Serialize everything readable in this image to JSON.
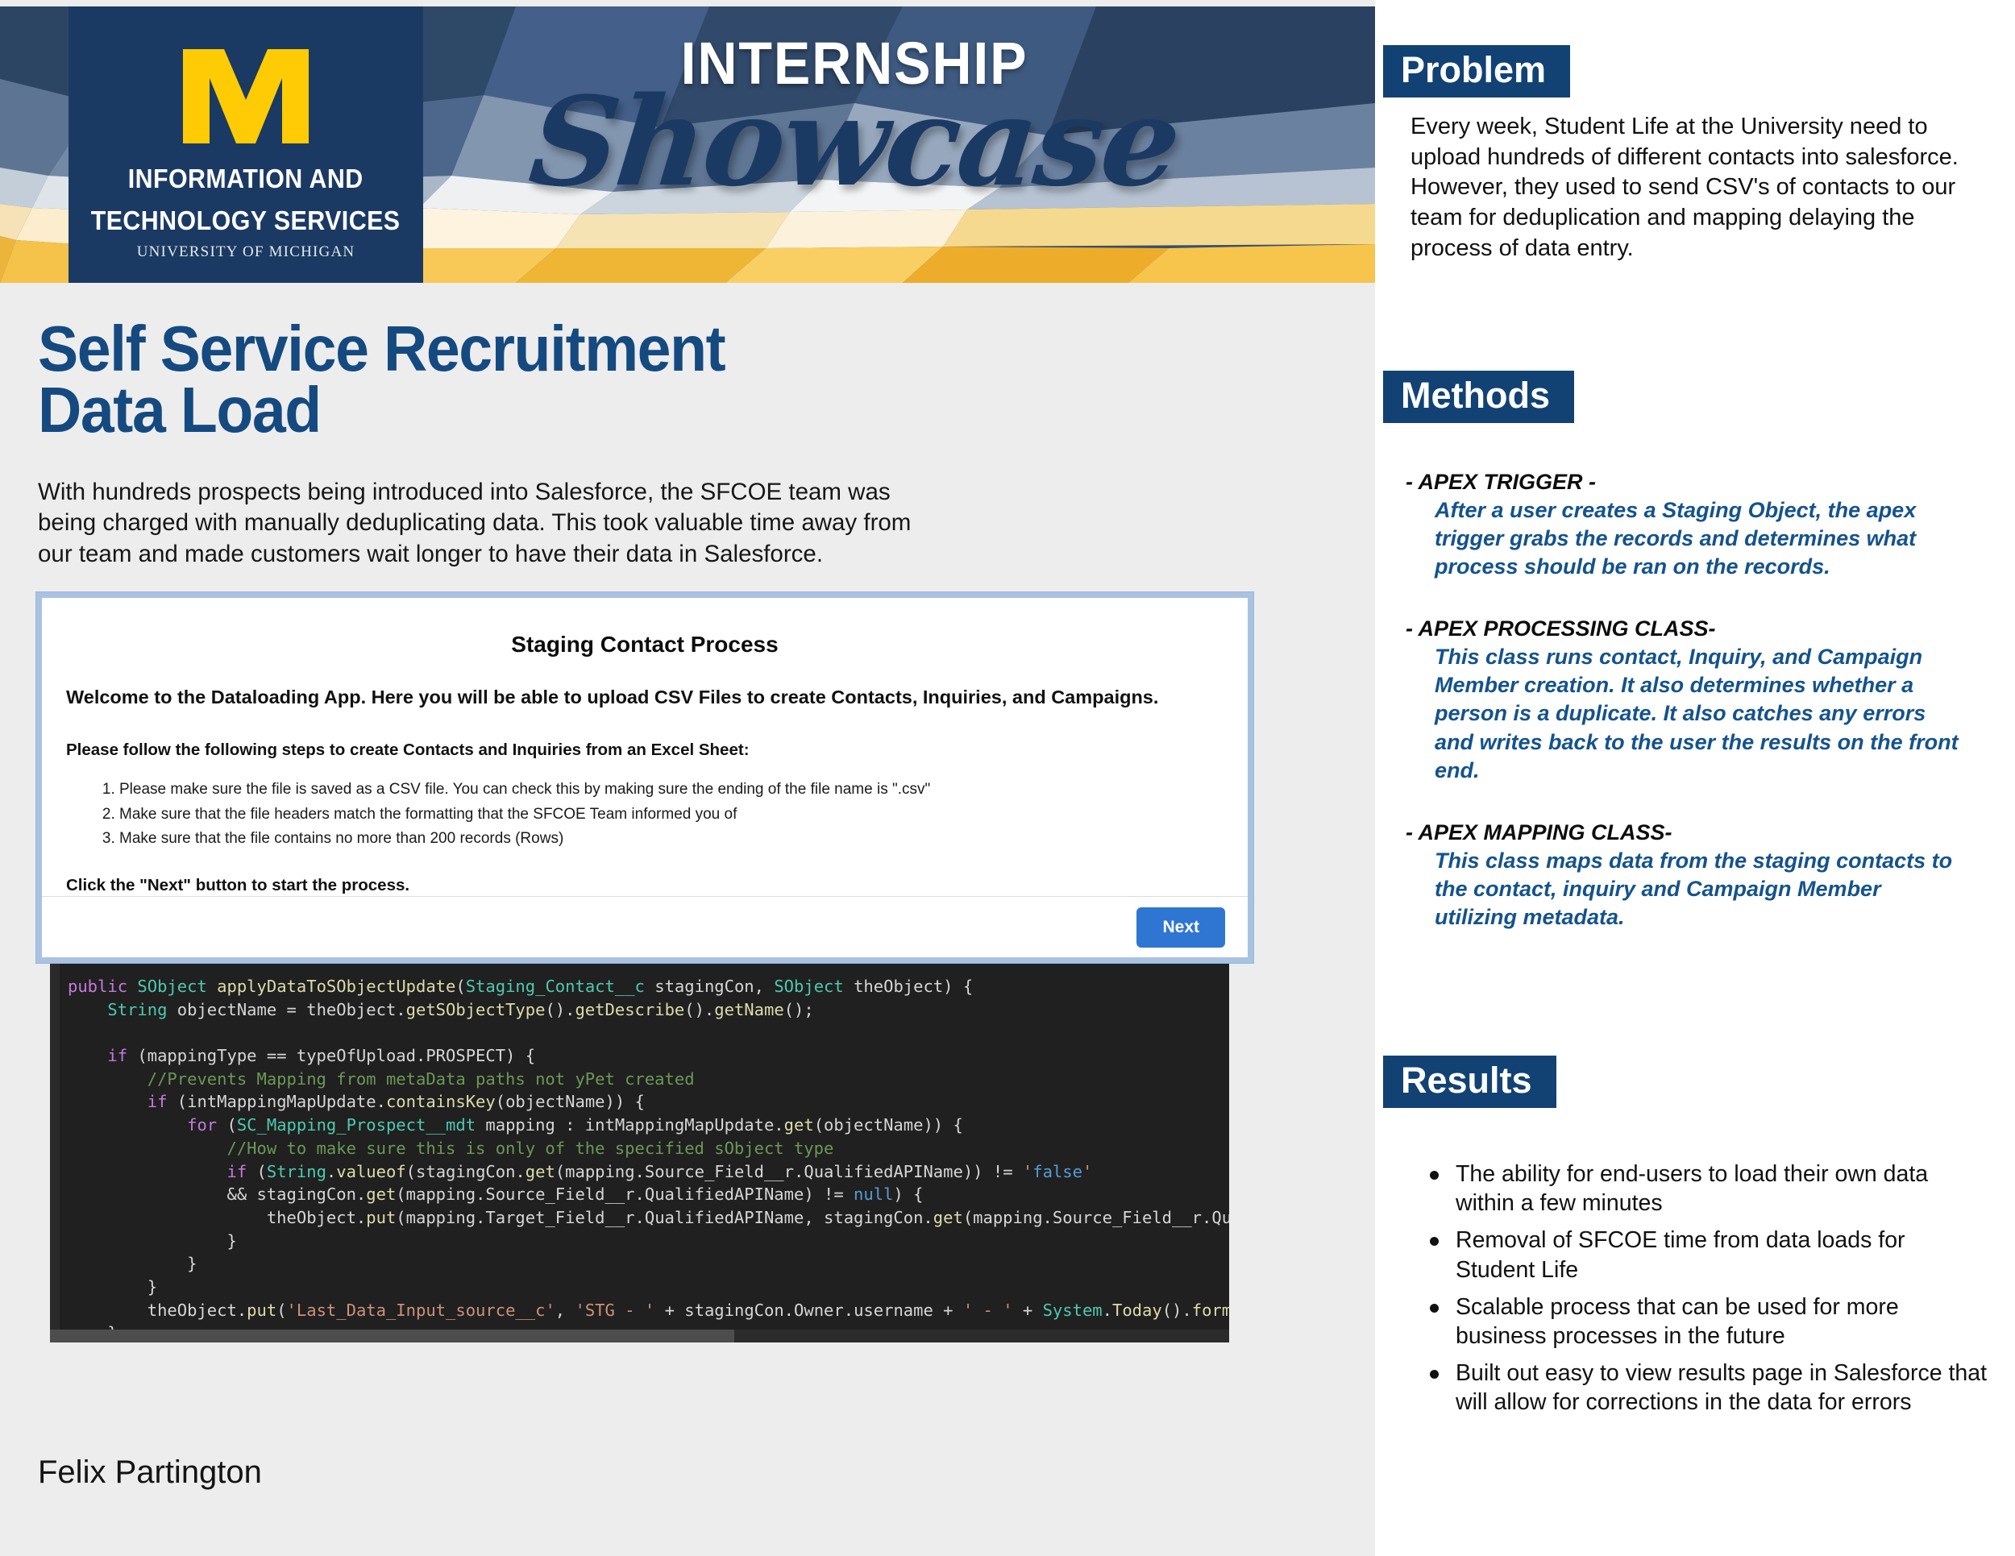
{
  "banner": {
    "internship_label": "INTERNSHIP",
    "showcase_label": "Showcase",
    "logo": {
      "block_m": "M",
      "org_line1": "INFORMATION AND",
      "org_line2": "TECHNOLOGY SERVICES",
      "university": "UNIVERSITY OF MICHIGAN"
    }
  },
  "poster": {
    "title": "Self Service Recruitment Data Load",
    "intro": "With hundreds prospects being introduced into Salesforce, the SFCOE team was being charged with manually deduplicating data. This took valuable time away from our team and made customers wait longer to have their data in Salesforce.",
    "author": "Felix Partington"
  },
  "app_screenshot": {
    "title": "Staging Contact Process",
    "lead": "Welcome to the Dataloading App. Here you will be able to upload CSV Files to create Contacts, Inquiries, and Campaigns.",
    "subheading": "Please follow the following steps to create Contacts and Inquiries from an Excel Sheet:",
    "steps": [
      "Please make sure the file is saved as a CSV file. You can check this by making sure the ending of the file name is \".csv\"",
      "Make sure that the file headers match the formatting that the SFCOE Team informed you of",
      "Make sure that the file contains no more than 200 records (Rows)"
    ],
    "click_note": "Click the \"Next\" button to start the process.",
    "next_button": "Next"
  },
  "code_block": {
    "language": "apex",
    "lines": [
      "public SObject applyDataToSObjectUpdate(Staging_Contact__c stagingCon, SObject theObject) {",
      "    String objectName = theObject.getSObjectType().getDescribe().getName();",
      "",
      "    if (mappingType == typeOfUpload.PROSPECT) {",
      "        //Prevents Mapping from metaData paths not yPet created",
      "        if (intMappingMapUpdate.containsKey(objectName)) {",
      "            for (SC_Mapping_Prospect__mdt mapping : intMappingMapUpdate.get(objectName)) {",
      "                //How to make sure this is only of the specified sObject type",
      "                if (String.valueof(stagingCon.get(mapping.Source_Field__r.QualifiedAPIName)) != 'false'",
      "                && stagingCon.get(mapping.Source_Field__r.QualifiedAPIName) != null) {",
      "                    theObject.put(mapping.Target_Field__r.QualifiedAPIName, stagingCon.get(mapping.Source_Field__r.QualifiedAP",
      "                }",
      "            }",
      "        }",
      "        theObject.put('Last_Data_Input_source__c', 'STG - ' + stagingCon.Owner.username + ' - ' + System.Today().format())",
      "    }",
      "}"
    ]
  },
  "sidebar": {
    "problem": {
      "heading": "Problem",
      "text": "Every week, Student Life at the University need to upload hundreds of different contacts into salesforce. However, they used to send CSV's of contacts to our team for deduplication and mapping delaying the process of data entry."
    },
    "methods": {
      "heading": "Methods",
      "items": [
        {
          "label": "- APEX TRIGGER -",
          "body": "After a user creates a Staging Object, the apex trigger grabs the records and determines what process should be ran on the records."
        },
        {
          "label": "- APEX PROCESSING CLASS-",
          "body": "This class runs contact, Inquiry, and Campaign Member creation. It also determines whether a person is a duplicate. It also catches any errors and writes back to the user the results on the front end."
        },
        {
          "label": "- APEX MAPPING CLASS-",
          "body": "This class maps data from the staging contacts to the contact, inquiry and Campaign Member utilizing metadata."
        }
      ]
    },
    "results": {
      "heading": "Results",
      "bullets": [
        "The ability for end-users to load their own data within a few minutes",
        "Removal of SFCOE time from data loads for Student Life",
        "Scalable process that can be used for more business processes in the future",
        "Built out easy to view results page in Salesforce that will allow for corrections in the data for errors"
      ]
    }
  },
  "colors": {
    "navy": "#124273",
    "maize": "#FFCB05",
    "title_blue": "#154A80",
    "method_body_blue": "#14538c",
    "button_blue": "#2f76d3",
    "page_bg": "#ededed"
  }
}
